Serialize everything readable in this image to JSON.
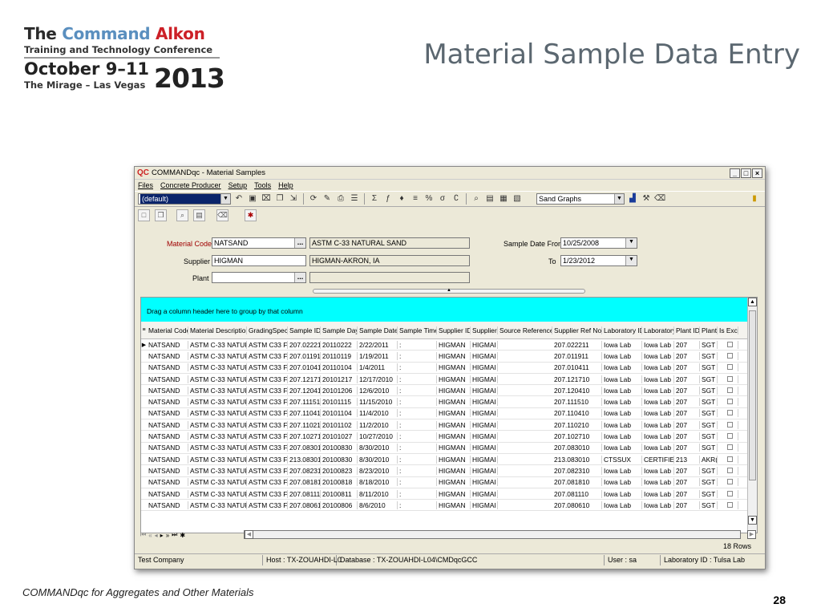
{
  "slide": {
    "logo": {
      "line1_a": "The",
      "line1_b": "Command",
      "line1_c": "Alkon",
      "line2": "Training and Technology Conference",
      "line3": "October 9–11",
      "line4": "The Mirage – Las Vegas",
      "year": "2013"
    },
    "title": "Material Sample Data Entry",
    "footer": "COMMANDqc for Aggregates and Other Materials",
    "page_number": "28"
  },
  "window": {
    "app_icon": "QC",
    "title": "COMMANDqc - Material Samples",
    "buttons": {
      "minimize": "_",
      "maximize": "□",
      "close": "×"
    },
    "menu": [
      "Files",
      "Concrete Producer",
      "Setup",
      "Tools",
      "Help"
    ],
    "toolbar": {
      "profile_value": "(default)",
      "graph_select_value": "Sand Graphs"
    },
    "form": {
      "material_code_label": "Material Code",
      "material_code_value": "NATSAND",
      "material_desc_value": "ASTM C-33 NATURAL SAND",
      "supplier_label": "Supplier",
      "supplier_value": "HIGMAN",
      "supplier_desc_value": "HIGMAN-AKRON, IA",
      "plant_label": "Plant",
      "plant_value": "",
      "date_from_label": "Sample Date From",
      "date_from_value": "10/25/2008",
      "date_to_label": "To",
      "date_to_value": "1/23/2012",
      "ellipsis": "..."
    },
    "grid": {
      "group_hint": "Drag a column header here to group by that column",
      "columns": [
        "Material Code",
        "Material Description",
        "GradingSpec",
        "Sample ID",
        "Sample Day",
        "Sample Date",
        "Sample Time",
        "Supplier ID",
        "Supplier",
        "Source Reference",
        "Supplier Ref No",
        "Laboratory ID",
        "Laboratory",
        "Plant ID",
        "Plant",
        "Is Exc"
      ],
      "rows": [
        [
          "NATSAND",
          "ASTM C-33 NATUF",
          "ASTM C33 Fi",
          "207.02221",
          "20110222",
          "2/22/2011",
          ":",
          "HIGMAN",
          "HIGMAI",
          "",
          "207.022211",
          "Iowa Lab",
          "Iowa Lab",
          "207",
          "SGT"
        ],
        [
          "NATSAND",
          "ASTM C-33 NATUF",
          "ASTM C33 Fi",
          "207.01191",
          "20110119",
          "1/19/2011",
          ":",
          "HIGMAN",
          "HIGMAI",
          "",
          "207.011911",
          "Iowa Lab",
          "Iowa Lab",
          "207",
          "SGT"
        ],
        [
          "NATSAND",
          "ASTM C-33 NATUF",
          "ASTM C33 Fi",
          "207.01041",
          "20110104",
          "1/4/2011",
          ":",
          "HIGMAN",
          "HIGMAI",
          "",
          "207.010411",
          "Iowa Lab",
          "Iowa Lab",
          "207",
          "SGT"
        ],
        [
          "NATSAND",
          "ASTM C-33 NATUF",
          "ASTM C33 Fi",
          "207.12171",
          "20101217",
          "12/17/2010",
          ":",
          "HIGMAN",
          "HIGMAI",
          "",
          "207.121710",
          "Iowa Lab",
          "Iowa Lab",
          "207",
          "SGT"
        ],
        [
          "NATSAND",
          "ASTM C-33 NATUF",
          "ASTM C33 Fi",
          "207.12041",
          "20101206",
          "12/6/2010",
          ":",
          "HIGMAN",
          "HIGMAI",
          "",
          "207.120410",
          "Iowa Lab",
          "Iowa Lab",
          "207",
          "SGT"
        ],
        [
          "NATSAND",
          "ASTM C-33 NATUF",
          "ASTM C33 Fi",
          "207.11151",
          "20101115",
          "11/15/2010",
          ":",
          "HIGMAN",
          "HIGMAI",
          "",
          "207.111510",
          "Iowa Lab",
          "Iowa Lab",
          "207",
          "SGT"
        ],
        [
          "NATSAND",
          "ASTM C-33 NATUF",
          "ASTM C33 Fi",
          "207.11041",
          "20101104",
          "11/4/2010",
          ":",
          "HIGMAN",
          "HIGMAI",
          "",
          "207.110410",
          "Iowa Lab",
          "Iowa Lab",
          "207",
          "SGT"
        ],
        [
          "NATSAND",
          "ASTM C-33 NATUF",
          "ASTM C33 Fi",
          "207.11021",
          "20101102",
          "11/2/2010",
          ":",
          "HIGMAN",
          "HIGMAI",
          "",
          "207.110210",
          "Iowa Lab",
          "Iowa Lab",
          "207",
          "SGT"
        ],
        [
          "NATSAND",
          "ASTM C-33 NATUF",
          "ASTM C33 Fi",
          "207.10271",
          "20101027",
          "10/27/2010",
          ":",
          "HIGMAN",
          "HIGMAI",
          "",
          "207.102710",
          "Iowa Lab",
          "Iowa Lab",
          "207",
          "SGT"
        ],
        [
          "NATSAND",
          "ASTM C-33 NATUF",
          "ASTM C33 Fi",
          "207.08301",
          "20100830",
          "8/30/2010",
          ":",
          "HIGMAN",
          "HIGMAI",
          "",
          "207.083010",
          "Iowa Lab",
          "Iowa Lab",
          "207",
          "SGT"
        ],
        [
          "NATSAND",
          "ASTM C-33 NATUF",
          "ASTM C33 Fi",
          "213.08301",
          "20100830",
          "8/30/2010",
          ":",
          "HIGMAN",
          "HIGMAI",
          "",
          "213.083010",
          "CTSSUX",
          "CERTIFIEI",
          "213",
          "AKR("
        ],
        [
          "NATSAND",
          "ASTM C-33 NATUF",
          "ASTM C33 Fi",
          "207.08231",
          "20100823",
          "8/23/2010",
          ":",
          "HIGMAN",
          "HIGMAI",
          "",
          "207.082310",
          "Iowa Lab",
          "Iowa Lab",
          "207",
          "SGT"
        ],
        [
          "NATSAND",
          "ASTM C-33 NATUF",
          "ASTM C33 Fi",
          "207.08181",
          "20100818",
          "8/18/2010",
          ":",
          "HIGMAN",
          "HIGMAI",
          "",
          "207.081810",
          "Iowa Lab",
          "Iowa Lab",
          "207",
          "SGT"
        ],
        [
          "NATSAND",
          "ASTM C-33 NATUF",
          "ASTM C33 Fi",
          "207.08111",
          "20100811",
          "8/11/2010",
          ":",
          "HIGMAN",
          "HIGMAI",
          "",
          "207.081110",
          "Iowa Lab",
          "Iowa Lab",
          "207",
          "SGT"
        ],
        [
          "NATSAND",
          "ASTM C-33 NATUF",
          "ASTM C33 Fi",
          "207.08061",
          "20100806",
          "8/6/2010",
          ":",
          "HIGMAN",
          "HIGMAI",
          "",
          "207.080610",
          "Iowa Lab",
          "Iowa Lab",
          "207",
          "SGT"
        ]
      ],
      "row_count": "18 Rows"
    },
    "status": {
      "company": "Test Company",
      "host": "Host : TX-ZOUAHDI-L0",
      "database": "Database : TX-ZOUAHDI-L04\\CMDqcGCC",
      "user": "User : sa",
      "lab": "Laboratory ID : Tulsa Lab"
    }
  }
}
